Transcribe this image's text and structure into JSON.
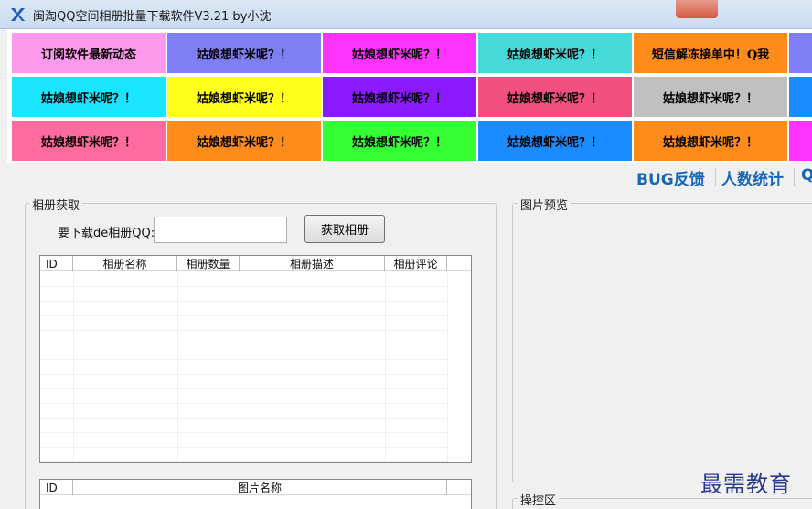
{
  "window": {
    "title": "闽淘QQ空间相册批量下载软件V3.21     by小沈"
  },
  "ads": {
    "rows": [
      [
        {
          "text": "订阅软件最新动态",
          "color": "#ff99ee"
        },
        {
          "text": "姑娘想虾米呢？！",
          "color": "#7f7ff5"
        },
        {
          "text": "姑娘想虾米呢？！",
          "color": "#ff33ff"
        },
        {
          "text": "姑娘想虾米呢？！",
          "color": "#45d9d9"
        },
        {
          "text": "短信解冻接单中！Q我",
          "color": "#ff8c1a"
        },
        {
          "text": "",
          "color": "#7f7ff5"
        }
      ],
      [
        {
          "text": "姑娘想虾米呢？！",
          "color": "#19e5ff"
        },
        {
          "text": "姑娘想虾米呢？！",
          "color": "#ffff1a"
        },
        {
          "text": "姑娘想虾米呢？！",
          "color": "#8c1aff"
        },
        {
          "text": "姑娘想虾米呢？！",
          "color": "#f25080"
        },
        {
          "text": "姑娘想虾米呢？！",
          "color": "#c0c0c0"
        },
        {
          "text": "",
          "color": "#1a8cff"
        }
      ],
      [
        {
          "text": "姑娘想虾米呢？！",
          "color": "#ff6b9e"
        },
        {
          "text": "姑娘想虾米呢？！",
          "color": "#ff8c1a"
        },
        {
          "text": "姑娘想虾米呢？！",
          "color": "#33ff33"
        },
        {
          "text": "姑娘想虾米呢？！",
          "color": "#1a8cff"
        },
        {
          "text": "姑娘想虾米呢？！",
          "color": "#ff8c1a"
        },
        {
          "text": "",
          "color": "#ff33ff"
        }
      ]
    ]
  },
  "links": {
    "bug_feedback": "BUG反馈",
    "user_stats": "人数统计",
    "qq_partial": "Q"
  },
  "album_group": {
    "legend": "相册获取",
    "qq_label": "要下载de相册QQ:",
    "qq_value": "",
    "fetch_button": "获取相册",
    "columns": [
      "ID",
      "相册名称",
      "相册数量",
      "相册描述",
      "相册评论"
    ]
  },
  "photo_list": {
    "columns": [
      "ID",
      "图片名称"
    ]
  },
  "preview_group": {
    "legend": "图片预览"
  },
  "control_group": {
    "legend": "操控区"
  },
  "watermark": "最需教育",
  "colors": {
    "link_blue": "#1665b8",
    "title_gradient_top": "#dbe8f6",
    "window_bg": "#f0f0f0"
  }
}
